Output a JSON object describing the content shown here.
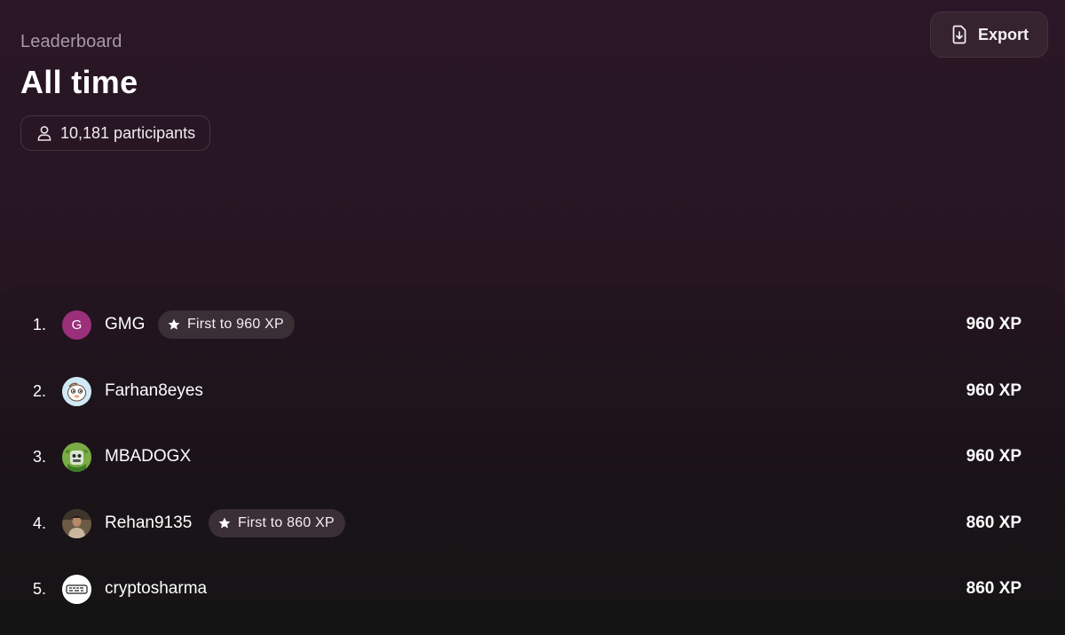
{
  "header": {
    "subtitle": "Leaderboard",
    "title": "All time",
    "participants_label": "10,181 participants",
    "export_label": "Export"
  },
  "leaderboard": [
    {
      "rank": "1.",
      "avatar_letter": "G",
      "name": "GMG",
      "badge": "First to 960 XP",
      "xp": "960 XP"
    },
    {
      "rank": "2.",
      "avatar_letter": "",
      "name": "Farhan8eyes",
      "badge": "",
      "xp": "960 XP"
    },
    {
      "rank": "3.",
      "avatar_letter": "",
      "name": "MBADOGX",
      "badge": "",
      "xp": "960 XP"
    },
    {
      "rank": "4.",
      "avatar_letter": "",
      "name": "Rehan9135",
      "badge": "First to 860 XP",
      "xp": "860 XP"
    },
    {
      "rank": "5.",
      "avatar_letter": "",
      "name": "cryptosharma",
      "badge": "",
      "xp": "860 XP"
    }
  ],
  "colors": {
    "background": "#231520",
    "avatar_gmg": "#9b2f7a",
    "badge_bg": "#3a2f35"
  },
  "icons": {
    "participants": "user-icon",
    "export": "file-download-icon",
    "badge": "star-icon"
  }
}
